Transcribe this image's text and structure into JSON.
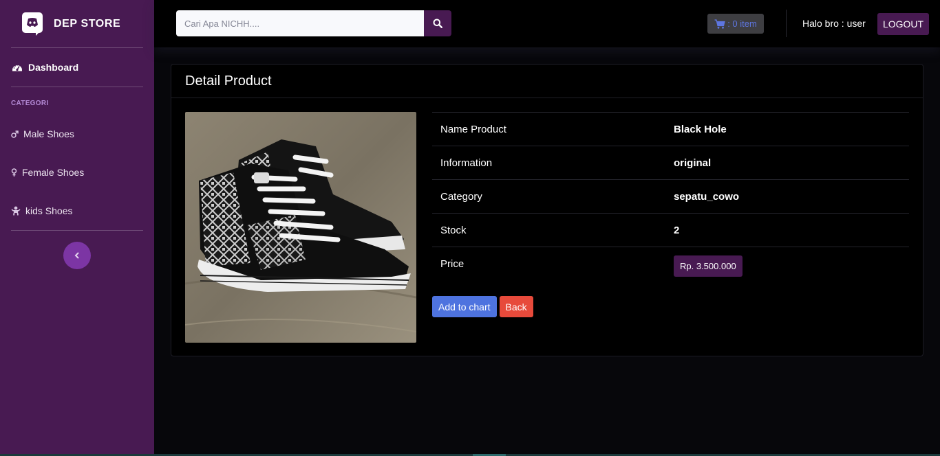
{
  "brand": {
    "name": "DEP STORE",
    "logo_icon": "discord-logo-icon"
  },
  "sidebar": {
    "dashboard": {
      "label": "Dashboard",
      "icon": "tachometer-icon"
    },
    "category_heading": "CATEGORI",
    "categories": [
      {
        "label": "Male Shoes",
        "icon": "mars-icon"
      },
      {
        "label": "Female Shoes",
        "icon": "venus-icon"
      },
      {
        "label": "kids Shoes",
        "icon": "baby-icon"
      }
    ],
    "toggle_icon": "chevron-left-icon"
  },
  "topbar": {
    "search_placeholder": "Cari Apa NICHH....",
    "search_icon": "search-icon",
    "cart_label": ": 0 item",
    "cart_icon": "cart-icon",
    "greeting": "Halo bro : user",
    "logout_label": "LOGOUT"
  },
  "card": {
    "title": "Detail Product",
    "image_alt": "black and white patterned high-top sneaker",
    "rows": [
      {
        "label": "Name Product",
        "value": "Black Hole"
      },
      {
        "label": "Information",
        "value": "original"
      },
      {
        "label": "Category",
        "value": "sepatu_cowo"
      },
      {
        "label": "Stock",
        "value": "2"
      },
      {
        "label": "Price",
        "value": "Rp. 3.500.000"
      }
    ],
    "add_button": "Add to chart",
    "back_button": "Back"
  },
  "colors": {
    "sidebar": "#481a52",
    "accent_blue": "#4e73df",
    "accent_red": "#e74a3b",
    "background": "#07070b"
  }
}
